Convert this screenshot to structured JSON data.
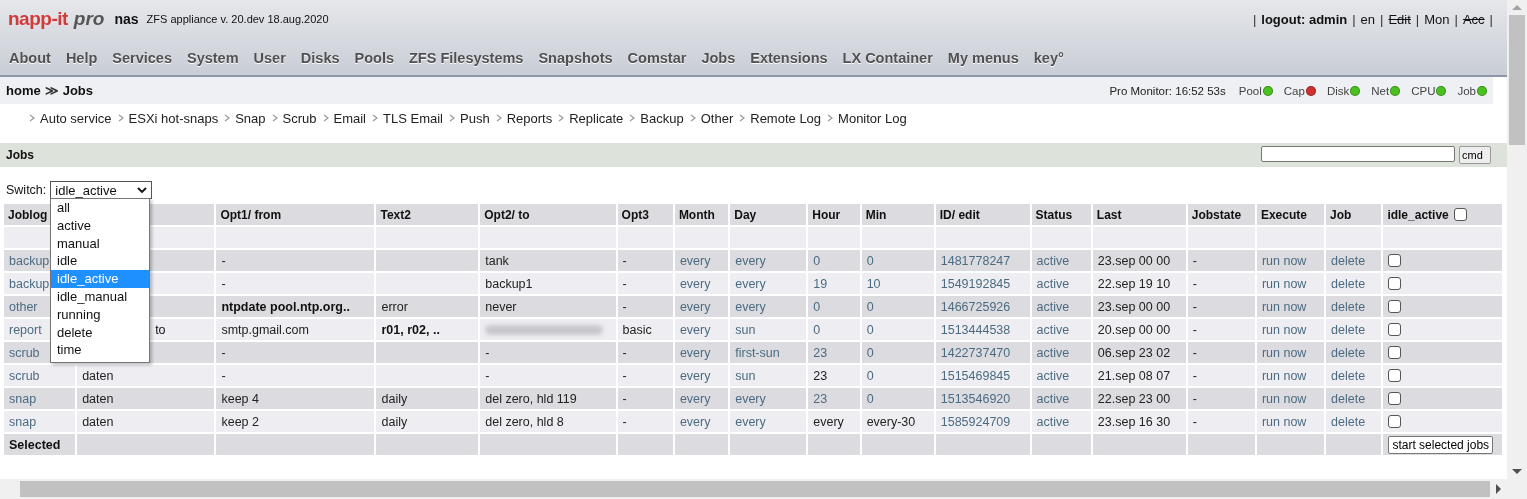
{
  "header": {
    "logo_brand": "napp-it",
    "logo_edition": "pro",
    "host": "nas",
    "version": "ZFS appliance v. 20.dev 18.aug.2020"
  },
  "user_links_separator": "|",
  "user_links": [
    {
      "label": "logout: admin",
      "disabled": false,
      "bold": true
    },
    {
      "label": "en",
      "disabled": false,
      "bold": false
    },
    {
      "label": "Edit",
      "disabled": true,
      "bold": false
    },
    {
      "label": "Mon",
      "disabled": false,
      "bold": false
    },
    {
      "label": "Acc",
      "disabled": true,
      "bold": false
    }
  ],
  "menu": [
    "About",
    "Help",
    "Services",
    "System",
    "User",
    "Disks",
    "Pools",
    "ZFS Filesystems",
    "Snapshots",
    "Comstar",
    "Jobs",
    "Extensions",
    "LX Container",
    "My menus",
    "key°"
  ],
  "breadcrumb": {
    "items": [
      "home",
      "Jobs"
    ],
    "separator": "≫"
  },
  "monitor": {
    "label": "Pro Monitor: 16:52 53s",
    "indicators": [
      {
        "label": "Pool",
        "color": "#4cc020"
      },
      {
        "label": "Cap",
        "color": "#d03030"
      },
      {
        "label": "Disk",
        "color": "#4cc020"
      },
      {
        "label": "Net",
        "color": "#4cc020"
      },
      {
        "label": "CPU",
        "color": "#4cc020"
      },
      {
        "label": "Job",
        "color": "#4cc020"
      }
    ]
  },
  "submenu": [
    "Auto service",
    "ESXi hot-snaps",
    "Snap",
    "Scrub",
    "Email",
    "TLS Email",
    "Push",
    "Reports",
    "Replicate",
    "Backup",
    "Other",
    "Remote Log",
    "Monitor Log"
  ],
  "section": {
    "title": "Jobs",
    "cmd_button": "cmd"
  },
  "switch": {
    "label": "Switch:",
    "value": "idle_active",
    "expanded": true,
    "options": [
      {
        "label": "all",
        "selected": false
      },
      {
        "label": "active",
        "selected": false
      },
      {
        "label": "manual",
        "selected": false
      },
      {
        "label": "idle",
        "selected": false
      },
      {
        "label": "idle_active",
        "selected": true
      },
      {
        "label": "idle_manual",
        "selected": false
      },
      {
        "label": "running",
        "selected": false
      },
      {
        "label": "delete",
        "selected": false
      },
      {
        "label": "time",
        "selected": false
      }
    ]
  },
  "table": {
    "columns": [
      {
        "label": "Joblog"
      },
      {},
      {
        "label": "Opt1/ from"
      },
      {
        "label": "Text2"
      },
      {
        "label": "Opt2/ to"
      },
      {
        "label": "Opt3"
      },
      {
        "label": "Month"
      },
      {
        "label": "Day"
      },
      {
        "label": "Hour"
      },
      {
        "label": "Min"
      },
      {
        "label": "ID/ edit"
      },
      {
        "label": "Status"
      },
      {
        "label": "Last"
      },
      {
        "label": "Jobstate"
      },
      {
        "label": "Execute"
      },
      {
        "label": "Job"
      },
      {
        "label": "idle_active",
        "kind": "checkbox",
        "checked": false
      }
    ],
    "rows": [
      {
        "kind": "blank"
      },
      {
        "kind": "job",
        "checked": false,
        "cells": [
          {
            "text": "backup",
            "kind": "link"
          },
          {},
          {
            "text": "-"
          },
          {},
          {
            "text": "tank"
          },
          {
            "text": "-"
          },
          {
            "text": "every",
            "kind": "link"
          },
          {
            "text": "every",
            "kind": "link"
          },
          {
            "text": "0",
            "kind": "link"
          },
          {
            "text": "0",
            "kind": "link"
          },
          {
            "text": "1481778247",
            "kind": "link"
          },
          {
            "text": "active",
            "kind": "link"
          },
          {
            "text": "23.sep 00 00"
          },
          {
            "text": "-"
          },
          {
            "text": "run now",
            "kind": "link"
          },
          {
            "text": "delete",
            "kind": "link"
          }
        ]
      },
      {
        "kind": "job",
        "checked": false,
        "cells": [
          {
            "text": "backup",
            "kind": "link"
          },
          {},
          {
            "text": "-"
          },
          {},
          {
            "text": "backup1"
          },
          {
            "text": "-"
          },
          {
            "text": "every",
            "kind": "link"
          },
          {
            "text": "every",
            "kind": "link"
          },
          {
            "text": "19",
            "kind": "link"
          },
          {
            "text": "10",
            "kind": "link"
          },
          {
            "text": "1549192845",
            "kind": "link"
          },
          {
            "text": "active",
            "kind": "link"
          },
          {
            "text": "22.sep 19 10"
          },
          {
            "text": "-"
          },
          {
            "text": "run now",
            "kind": "link"
          },
          {
            "text": "delete",
            "kind": "link"
          }
        ]
      },
      {
        "kind": "job",
        "checked": false,
        "cells": [
          {
            "text": "other",
            "kind": "link"
          },
          {},
          {
            "text": "ntpdate pool.ntp.org..",
            "kind": "bold"
          },
          {
            "text": "error"
          },
          {
            "text": "never"
          },
          {
            "text": "-"
          },
          {
            "text": "every",
            "kind": "link"
          },
          {
            "text": "every",
            "kind": "link"
          },
          {
            "text": "0",
            "kind": "link"
          },
          {
            "text": "0",
            "kind": "link"
          },
          {
            "text": "1466725926",
            "kind": "link"
          },
          {
            "text": "active",
            "kind": "link"
          },
          {
            "text": "23.sep 00 00"
          },
          {
            "text": "-"
          },
          {
            "text": "run now",
            "kind": "link"
          },
          {
            "text": "delete",
            "kind": "link"
          }
        ]
      },
      {
        "kind": "job",
        "checked": false,
        "cells": [
          {
            "text": "report",
            "kind": "link"
          },
          {
            "text": "to",
            "kind": "covered"
          },
          {
            "text": "smtp.gmail.com"
          },
          {
            "text": "r01, r02, ..",
            "kind": "bold"
          },
          {
            "kind": "blurred"
          },
          {
            "text": "basic"
          },
          {
            "text": "every",
            "kind": "link"
          },
          {
            "text": "sun",
            "kind": "link"
          },
          {
            "text": "0",
            "kind": "link"
          },
          {
            "text": "0",
            "kind": "link"
          },
          {
            "text": "1513444538",
            "kind": "link"
          },
          {
            "text": "active",
            "kind": "link"
          },
          {
            "text": "20.sep 00 00"
          },
          {
            "text": "-"
          },
          {
            "text": "run now",
            "kind": "link"
          },
          {
            "text": "delete",
            "kind": "link"
          }
        ]
      },
      {
        "kind": "job",
        "checked": false,
        "cells": [
          {
            "text": "scrub",
            "kind": "link"
          },
          {},
          {
            "text": "-"
          },
          {},
          {
            "text": "-"
          },
          {
            "text": "-"
          },
          {
            "text": "every",
            "kind": "link"
          },
          {
            "text": "first-sun",
            "kind": "link"
          },
          {
            "text": "23",
            "kind": "link"
          },
          {
            "text": "0",
            "kind": "link"
          },
          {
            "text": "1422737470",
            "kind": "link"
          },
          {
            "text": "active",
            "kind": "link"
          },
          {
            "text": "06.sep 23 02"
          },
          {
            "text": "-"
          },
          {
            "text": "run now",
            "kind": "link"
          },
          {
            "text": "delete",
            "kind": "link"
          }
        ]
      },
      {
        "kind": "job",
        "checked": false,
        "cells": [
          {
            "text": "scrub",
            "kind": "link"
          },
          {
            "text": "daten"
          },
          {
            "text": "-"
          },
          {},
          {
            "text": "-"
          },
          {
            "text": "-"
          },
          {
            "text": "every",
            "kind": "link"
          },
          {
            "text": "sun",
            "kind": "link"
          },
          {
            "text": "23"
          },
          {
            "text": "0",
            "kind": "link"
          },
          {
            "text": "1515469845",
            "kind": "link"
          },
          {
            "text": "active",
            "kind": "link"
          },
          {
            "text": "21.sep 08 07"
          },
          {
            "text": "-"
          },
          {
            "text": "run now",
            "kind": "link"
          },
          {
            "text": "delete",
            "kind": "link"
          }
        ]
      },
      {
        "kind": "job",
        "checked": false,
        "cells": [
          {
            "text": "snap",
            "kind": "link"
          },
          {
            "text": "daten"
          },
          {
            "text": "keep 4"
          },
          {
            "text": "daily"
          },
          {
            "text": "del zero, hld 119"
          },
          {
            "text": "-"
          },
          {
            "text": "every",
            "kind": "link"
          },
          {
            "text": "every",
            "kind": "link"
          },
          {
            "text": "23",
            "kind": "link"
          },
          {
            "text": "0",
            "kind": "link"
          },
          {
            "text": "1513546920",
            "kind": "link"
          },
          {
            "text": "active",
            "kind": "link"
          },
          {
            "text": "22.sep 23 00"
          },
          {
            "text": "-"
          },
          {
            "text": "run now",
            "kind": "link"
          },
          {
            "text": "delete",
            "kind": "link"
          }
        ]
      },
      {
        "kind": "job",
        "checked": false,
        "cells": [
          {
            "text": "snap",
            "kind": "link"
          },
          {
            "text": "daten"
          },
          {
            "text": "keep 2"
          },
          {
            "text": "daily"
          },
          {
            "text": "del zero, hld 8"
          },
          {
            "text": "-"
          },
          {
            "text": "every",
            "kind": "link"
          },
          {
            "text": "every",
            "kind": "link"
          },
          {
            "text": "every"
          },
          {
            "text": "every-30"
          },
          {
            "text": "1585924709",
            "kind": "link"
          },
          {
            "text": "active",
            "kind": "link"
          },
          {
            "text": "23.sep 16 30"
          },
          {
            "text": "-"
          },
          {
            "text": "run now",
            "kind": "link"
          },
          {
            "text": "delete",
            "kind": "link"
          }
        ]
      },
      {
        "kind": "footer",
        "label": "Selected",
        "button": "start selected jobs"
      }
    ]
  }
}
